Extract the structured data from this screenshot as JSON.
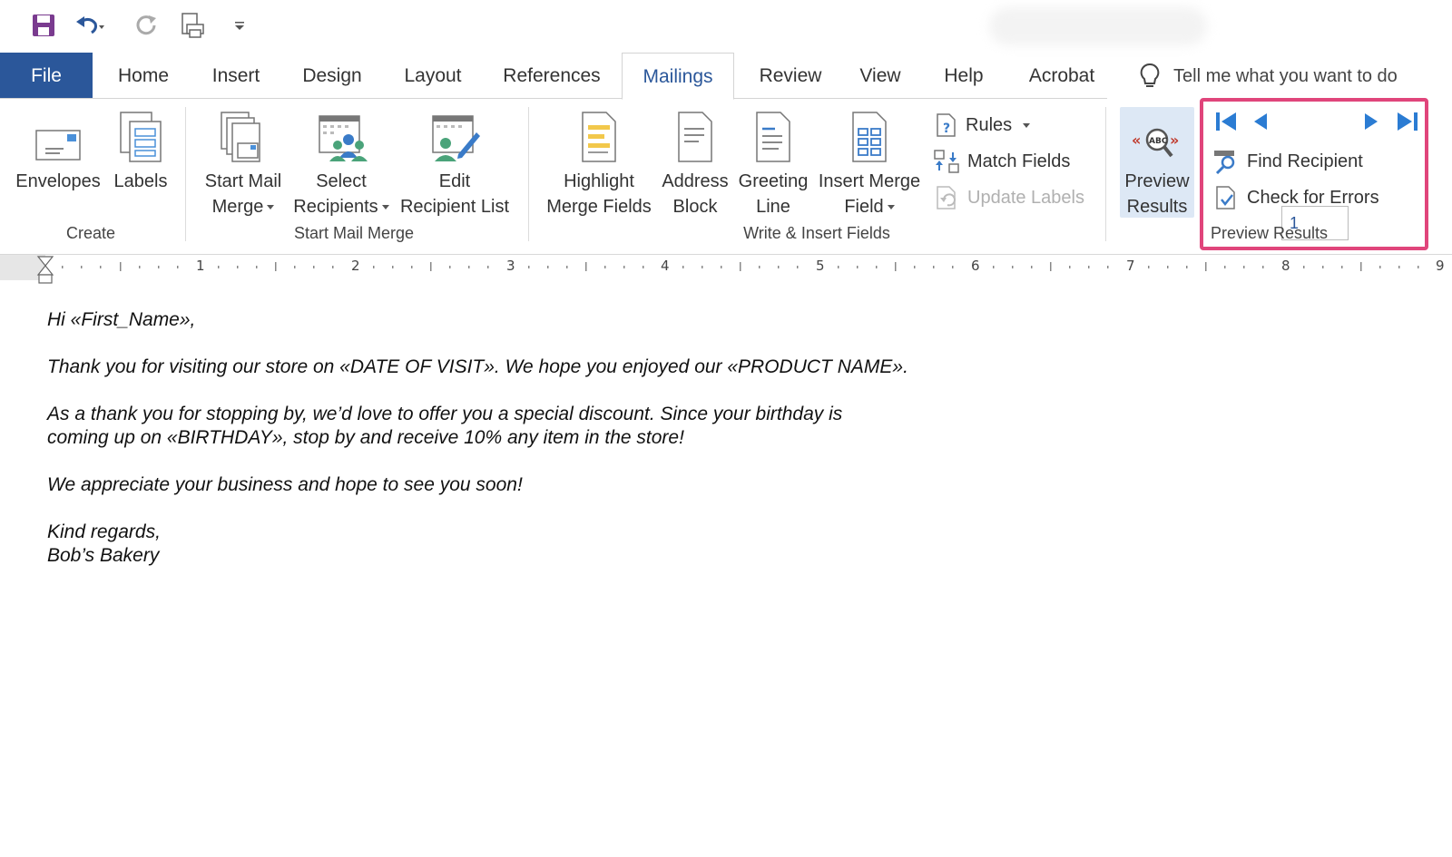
{
  "qat": {
    "icons": [
      "save-icon",
      "undo-icon",
      "redo-icon",
      "print-preview-icon",
      "customize-qat-icon"
    ]
  },
  "tabs": {
    "file": "File",
    "items": [
      "Home",
      "Insert",
      "Design",
      "Layout",
      "References",
      "Mailings",
      "Review",
      "View",
      "Help",
      "Acrobat"
    ],
    "active": "Mailings",
    "tell_me": "Tell me what you want to do"
  },
  "ribbon": {
    "create": {
      "label": "Create",
      "envelopes": "Envelopes",
      "labels": "Labels"
    },
    "start_mail_merge": {
      "label": "Start Mail Merge",
      "start_mail_merge_l1": "Start Mail",
      "start_mail_merge_l2": "Merge",
      "select_recipients_l1": "Select",
      "select_recipients_l2": "Recipients",
      "edit_list_l1": "Edit",
      "edit_list_l2": "Recipient List"
    },
    "write_insert": {
      "label": "Write & Insert Fields",
      "highlight_l1": "Highlight",
      "highlight_l2": "Merge Fields",
      "address_l1": "Address",
      "address_l2": "Block",
      "greeting_l1": "Greeting",
      "greeting_l2": "Line",
      "insert_field_l1": "Insert Merge",
      "insert_field_l2": "Field",
      "rules": "Rules",
      "match_fields": "Match Fields",
      "update_labels": "Update Labels"
    },
    "preview": {
      "label": "Preview Results",
      "preview_l1": "Preview",
      "preview_l2": "Results",
      "record_value": "1",
      "find_recipient": "Find Recipient",
      "check_errors": "Check for Errors"
    }
  },
  "ruler": {
    "numbers": [
      "1",
      "2",
      "3",
      "4",
      "5",
      "6",
      "7",
      "8",
      "9"
    ]
  },
  "document": {
    "line1": "Hi «First_Name»,",
    "line2": "Thank you for visiting our store on «DATE OF VISIT». We hope you enjoyed our «PRODUCT NAME».",
    "line3a": "As a thank you for stopping by, we’d love to offer you a special discount. Since your birthday is",
    "line3b": "coming up on «BIRTHDAY», stop by and receive 10% any item in the store!",
    "line4": "We appreciate your business and hope to see you soon!",
    "line5a": "Kind regards,",
    "line5b": "Bob’s Bakery"
  },
  "colors": {
    "file_tab": "#2b579a",
    "active_tab_text": "#2b579a",
    "highlight_box": "#e0457b",
    "nav_arrows": "#2b7cd3"
  }
}
